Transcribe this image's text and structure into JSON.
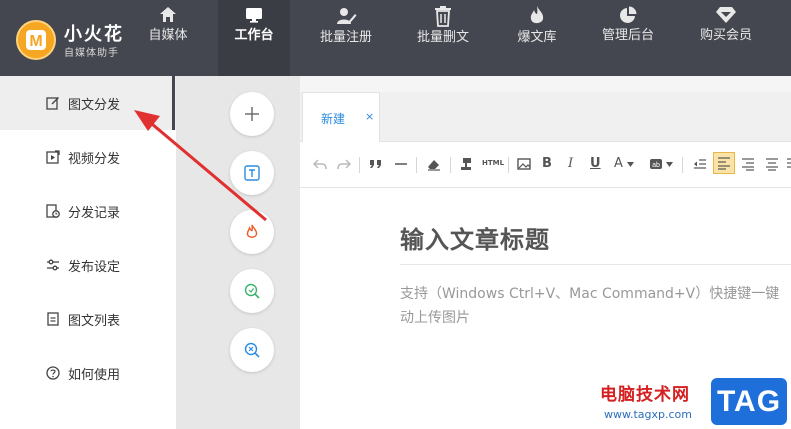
{
  "app": {
    "title": "小火花",
    "subtitle": "自媒体助手",
    "logo_letter": "M"
  },
  "nav": [
    {
      "label": "自媒体",
      "icon": "home-icon",
      "active": false
    },
    {
      "label": "工作台",
      "icon": "monitor-icon",
      "active": true
    },
    {
      "label": "批量注册",
      "icon": "user-edit-icon",
      "active": false
    },
    {
      "label": "批量删文",
      "icon": "trash-icon",
      "active": false
    },
    {
      "label": "爆文库",
      "icon": "flame-icon",
      "active": false
    },
    {
      "label": "管理后台",
      "icon": "pie-chart-icon",
      "active": false
    },
    {
      "label": "购买会员",
      "icon": "diamond-icon",
      "active": false
    }
  ],
  "sidebar": {
    "items": [
      {
        "label": "图文分发",
        "icon": "edit-icon",
        "active": true
      },
      {
        "label": "视频分发",
        "icon": "video-share-icon",
        "active": false
      },
      {
        "label": "分发记录",
        "icon": "record-icon",
        "active": false
      },
      {
        "label": "发布设定",
        "icon": "sliders-icon",
        "active": false
      },
      {
        "label": "图文列表",
        "icon": "list-doc-icon",
        "active": false
      },
      {
        "label": "如何使用",
        "icon": "help-icon",
        "active": false
      }
    ]
  },
  "tools": [
    {
      "icon": "plus-icon"
    },
    {
      "icon": "text-box-icon"
    },
    {
      "icon": "fire-icon"
    },
    {
      "icon": "search-refresh-icon"
    },
    {
      "icon": "search-clear-icon"
    }
  ],
  "editor": {
    "tab_label": "新建",
    "tab_close": "×",
    "title_placeholder": "输入文章标题",
    "hint_line1": "支持（Windows Ctrl+V、Mac Command+V）快捷键一键",
    "hint_line2": "动上传图片",
    "toolbar": {
      "html_label": "HTML",
      "bold": "B",
      "italic": "I",
      "underline": "U",
      "font_color": "A"
    }
  },
  "watermark": {
    "text": "电脑技术网",
    "url": "www.tagxp.com",
    "badge": "TAG"
  },
  "colors": {
    "topbar": "#44474f",
    "accent": "#2b8ce0",
    "arrow": "#e03030"
  }
}
